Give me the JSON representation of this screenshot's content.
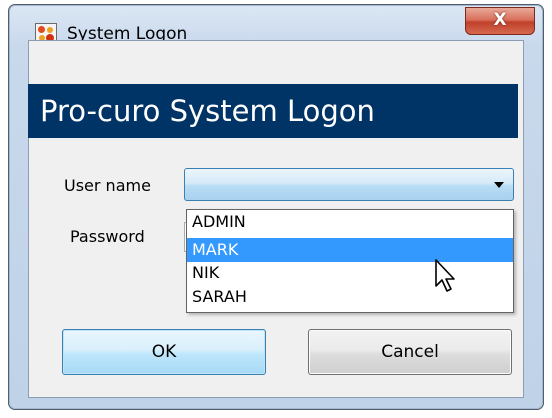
{
  "window": {
    "title": "System Logon",
    "close_glyph": "X"
  },
  "banner": {
    "title": "Pro-curo System Logon",
    "color": "#003366"
  },
  "form": {
    "username_label": "User name",
    "password_label": "Password",
    "username_value": "",
    "password_value": ""
  },
  "dropdown": {
    "items": [
      "ADMIN",
      "MARK",
      "NIK",
      "SARAH"
    ],
    "selected_index": 1,
    "selected_color": "#3399ff"
  },
  "buttons": {
    "ok_label": "OK",
    "cancel_label": "Cancel"
  },
  "icons": {
    "app": "pro-curo-logo-icon",
    "cursor": "mouse-pointer-icon"
  }
}
